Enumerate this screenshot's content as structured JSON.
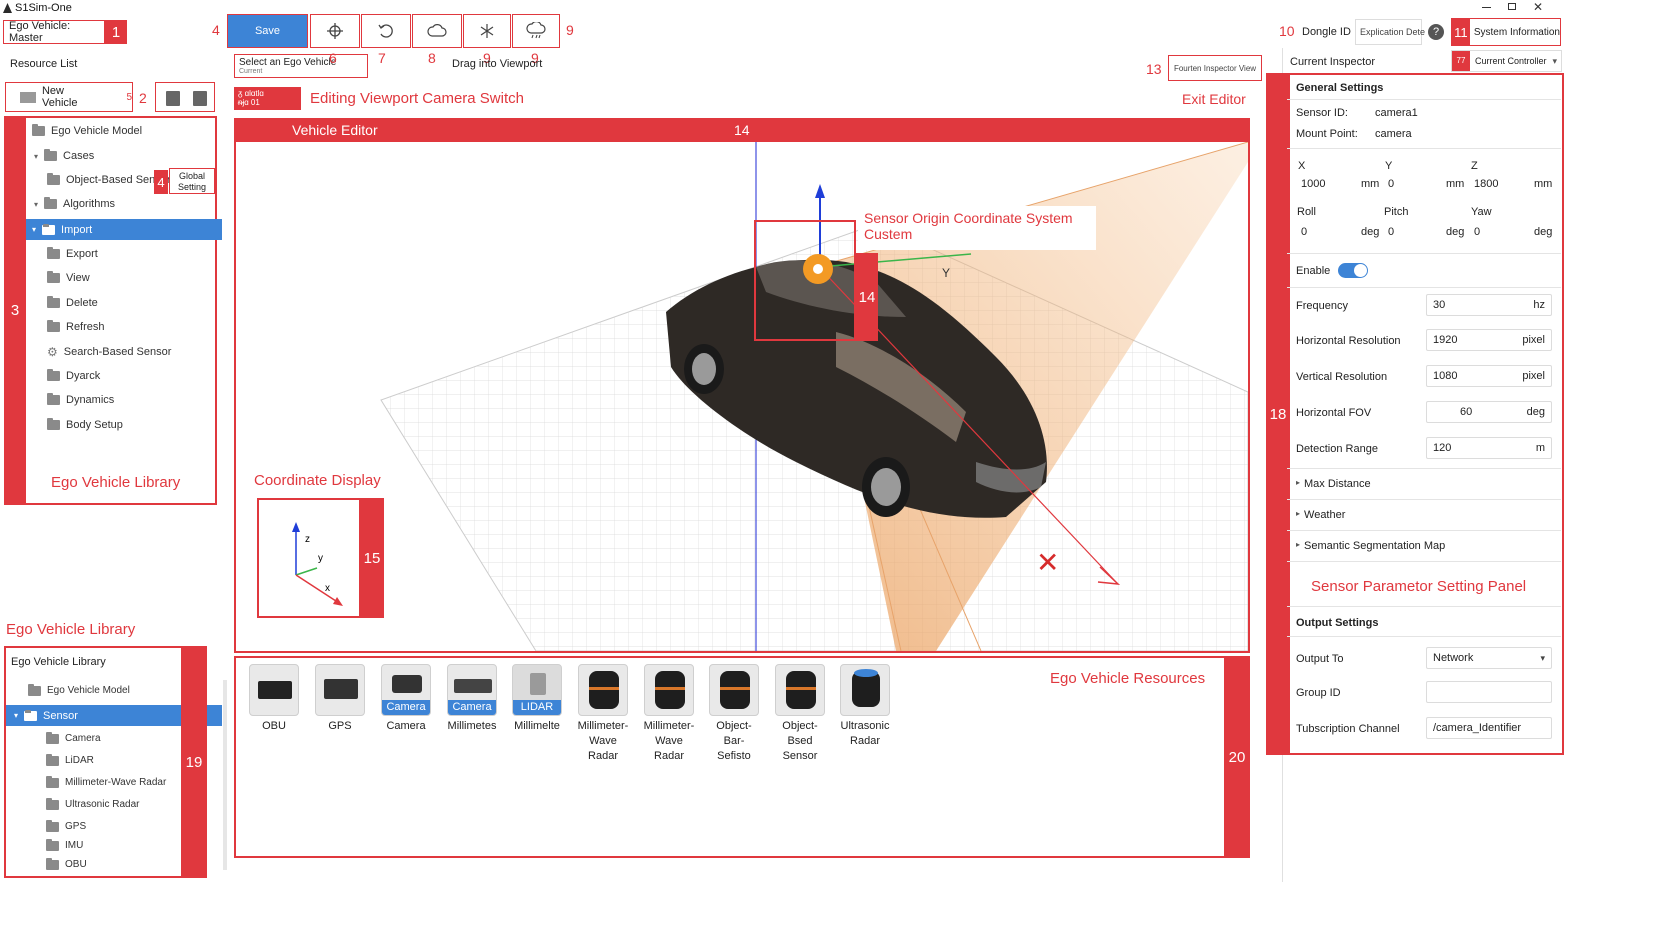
{
  "window": {
    "title": "S1Sim-One"
  },
  "toolbar": {
    "ego_vehicle": "Ego Vehicle: Master",
    "save": "Save",
    "dongle_label": "Dongle ID",
    "dongle_value": "Explication Dete",
    "system_info": "System Information",
    "current_controller": "Current Controller",
    "current_inspector": "Current Inspector",
    "select_ego_line1": "Select an Ego Vehicle",
    "select_ego_line2": "Current",
    "drag_into_viewport": "Drag into Viewport",
    "return_inspector_view": "Fourten Inspector View",
    "icons": [
      "move-icon",
      "rotate-icon",
      "cloud-icon",
      "snow-icon",
      "rain-icon"
    ]
  },
  "callout_numbers": [
    "1",
    "2",
    "3",
    "4",
    "5",
    "6",
    "7",
    "8",
    "9",
    "9",
    "9",
    "10",
    "11",
    "13",
    "14",
    "14",
    "15",
    "18",
    "19",
    "20"
  ],
  "annotations": {
    "camera_switch": "Editing Viewport Camera Switch",
    "exit_editor": "Exit Editor",
    "vehicle_editor": "Vehicle Editor",
    "sensor_origin_1": "Sensor Origin Coordinate System",
    "sensor_origin_2": "Custem",
    "coordinate_display": "Coordinate Display",
    "ego_vehicle_library": "Ego Vehicle Library",
    "ego_vehicle_library_2": "Ego Vehicle Library",
    "ego_vehicle_resources": "Ego Vehicle Resources",
    "sensor_panel": "Sensor Parametor Setting Panel",
    "camera_tag_line1": "ᵹ ɑlɑtlɑ",
    "camera_tag_line2": "ᵰɉɑ 01"
  },
  "resource_list": {
    "title": "Resource List",
    "new_vehicle": "New Vehicle",
    "global_setting_1": "Global",
    "global_setting_2": "Setting",
    "tree": [
      {
        "label": "Ego Vehicle Model"
      },
      {
        "label": "Cases"
      },
      {
        "label": "Object-Based Sensor"
      },
      {
        "label": "Algorithms"
      },
      {
        "label": "Import"
      },
      {
        "label": "Export"
      },
      {
        "label": "View"
      },
      {
        "label": "Delete"
      },
      {
        "label": "Refresh"
      },
      {
        "label": "Search-Based Sensor"
      },
      {
        "label": "Dyarck"
      },
      {
        "label": "Dynamics"
      },
      {
        "label": "Body Setup"
      }
    ]
  },
  "library": {
    "title": "Ego Vehicle Library",
    "tree": [
      {
        "label": "Ego Vehicle Model"
      },
      {
        "label": "Sensor"
      },
      {
        "label": "Camera"
      },
      {
        "label": "LiDAR"
      },
      {
        "label": "Millimeter-Wave Radar"
      },
      {
        "label": "Ultrasonic Radar"
      },
      {
        "label": "GPS"
      },
      {
        "label": "IMU"
      },
      {
        "label": "OBU"
      }
    ]
  },
  "coordinate_axes": {
    "z": "z",
    "y": "y",
    "x": "x"
  },
  "viewport_axis": {
    "y": "Y"
  },
  "resources": [
    {
      "label1": "OBU",
      "label2": "",
      "tag": ""
    },
    {
      "label1": "GPS",
      "label2": "",
      "tag": ""
    },
    {
      "label1": "Camera",
      "label2": "",
      "tag": "Camera"
    },
    {
      "label1": "Millimetes",
      "label2": "",
      "tag": "Camera"
    },
    {
      "label1": "Millimelte",
      "label2": "",
      "tag": "LIDAR"
    },
    {
      "label1": "Millimeter-",
      "label2": "Wave Radar",
      "tag": ""
    },
    {
      "label1": "Millimeter-",
      "label2": "Wave Radar",
      "tag": ""
    },
    {
      "label1": "Object-Bar-",
      "label2": "Sefisto",
      "tag": ""
    },
    {
      "label1": "Object-Bsed",
      "label2": "Sensor",
      "tag": ""
    },
    {
      "label1": "Ultrasonic",
      "label2": "Radar",
      "tag": ""
    }
  ],
  "inspector": {
    "general_settings": "General Settings",
    "sensor_id_label": "Sensor ID:",
    "sensor_id_value": "camera1",
    "mount_point_label": "Mount Point:",
    "mount_point_value": "camera",
    "x_label": "X",
    "y_label": "Y",
    "z_label": "Z",
    "x_value": "1000",
    "y_value": "0",
    "z_value": "1800",
    "unit_mm": "mm",
    "roll_label": "Roll",
    "pitch_label": "Pitch",
    "yaw_label": "Yaw",
    "roll_value": "0",
    "pitch_value": "0",
    "yaw_value": "0",
    "unit_deg": "deg",
    "enable_label": "Enable",
    "enable_on": true,
    "frequency_label": "Frequency",
    "frequency_value": "30",
    "frequency_unit": "hz",
    "hres_label": "Horizontal Resolution",
    "hres_value": "1920",
    "hres_unit": "pixel",
    "vres_label": "Vertical Resolution",
    "vres_value": "1080",
    "vres_unit": "pixel",
    "hfov_label": "Horizontal FOV",
    "hfov_value": "60",
    "hfov_unit": "deg",
    "range_label": "Detection Range",
    "range_value": "120",
    "range_unit": "m",
    "max_distance": "Max Distance",
    "weather": "Weather",
    "semantic_map": "Semantic Segmentation Map",
    "output_settings": "Output Settings",
    "output_to_label": "Output To",
    "output_to_value": "Network",
    "group_id_label": "Group ID",
    "group_id_value": "",
    "channel_label": "Tubscription Channel",
    "channel_value": "/camera_Identifier"
  },
  "colors": {
    "accent_red": "#e0383e",
    "accent_blue": "#3d84d6"
  }
}
